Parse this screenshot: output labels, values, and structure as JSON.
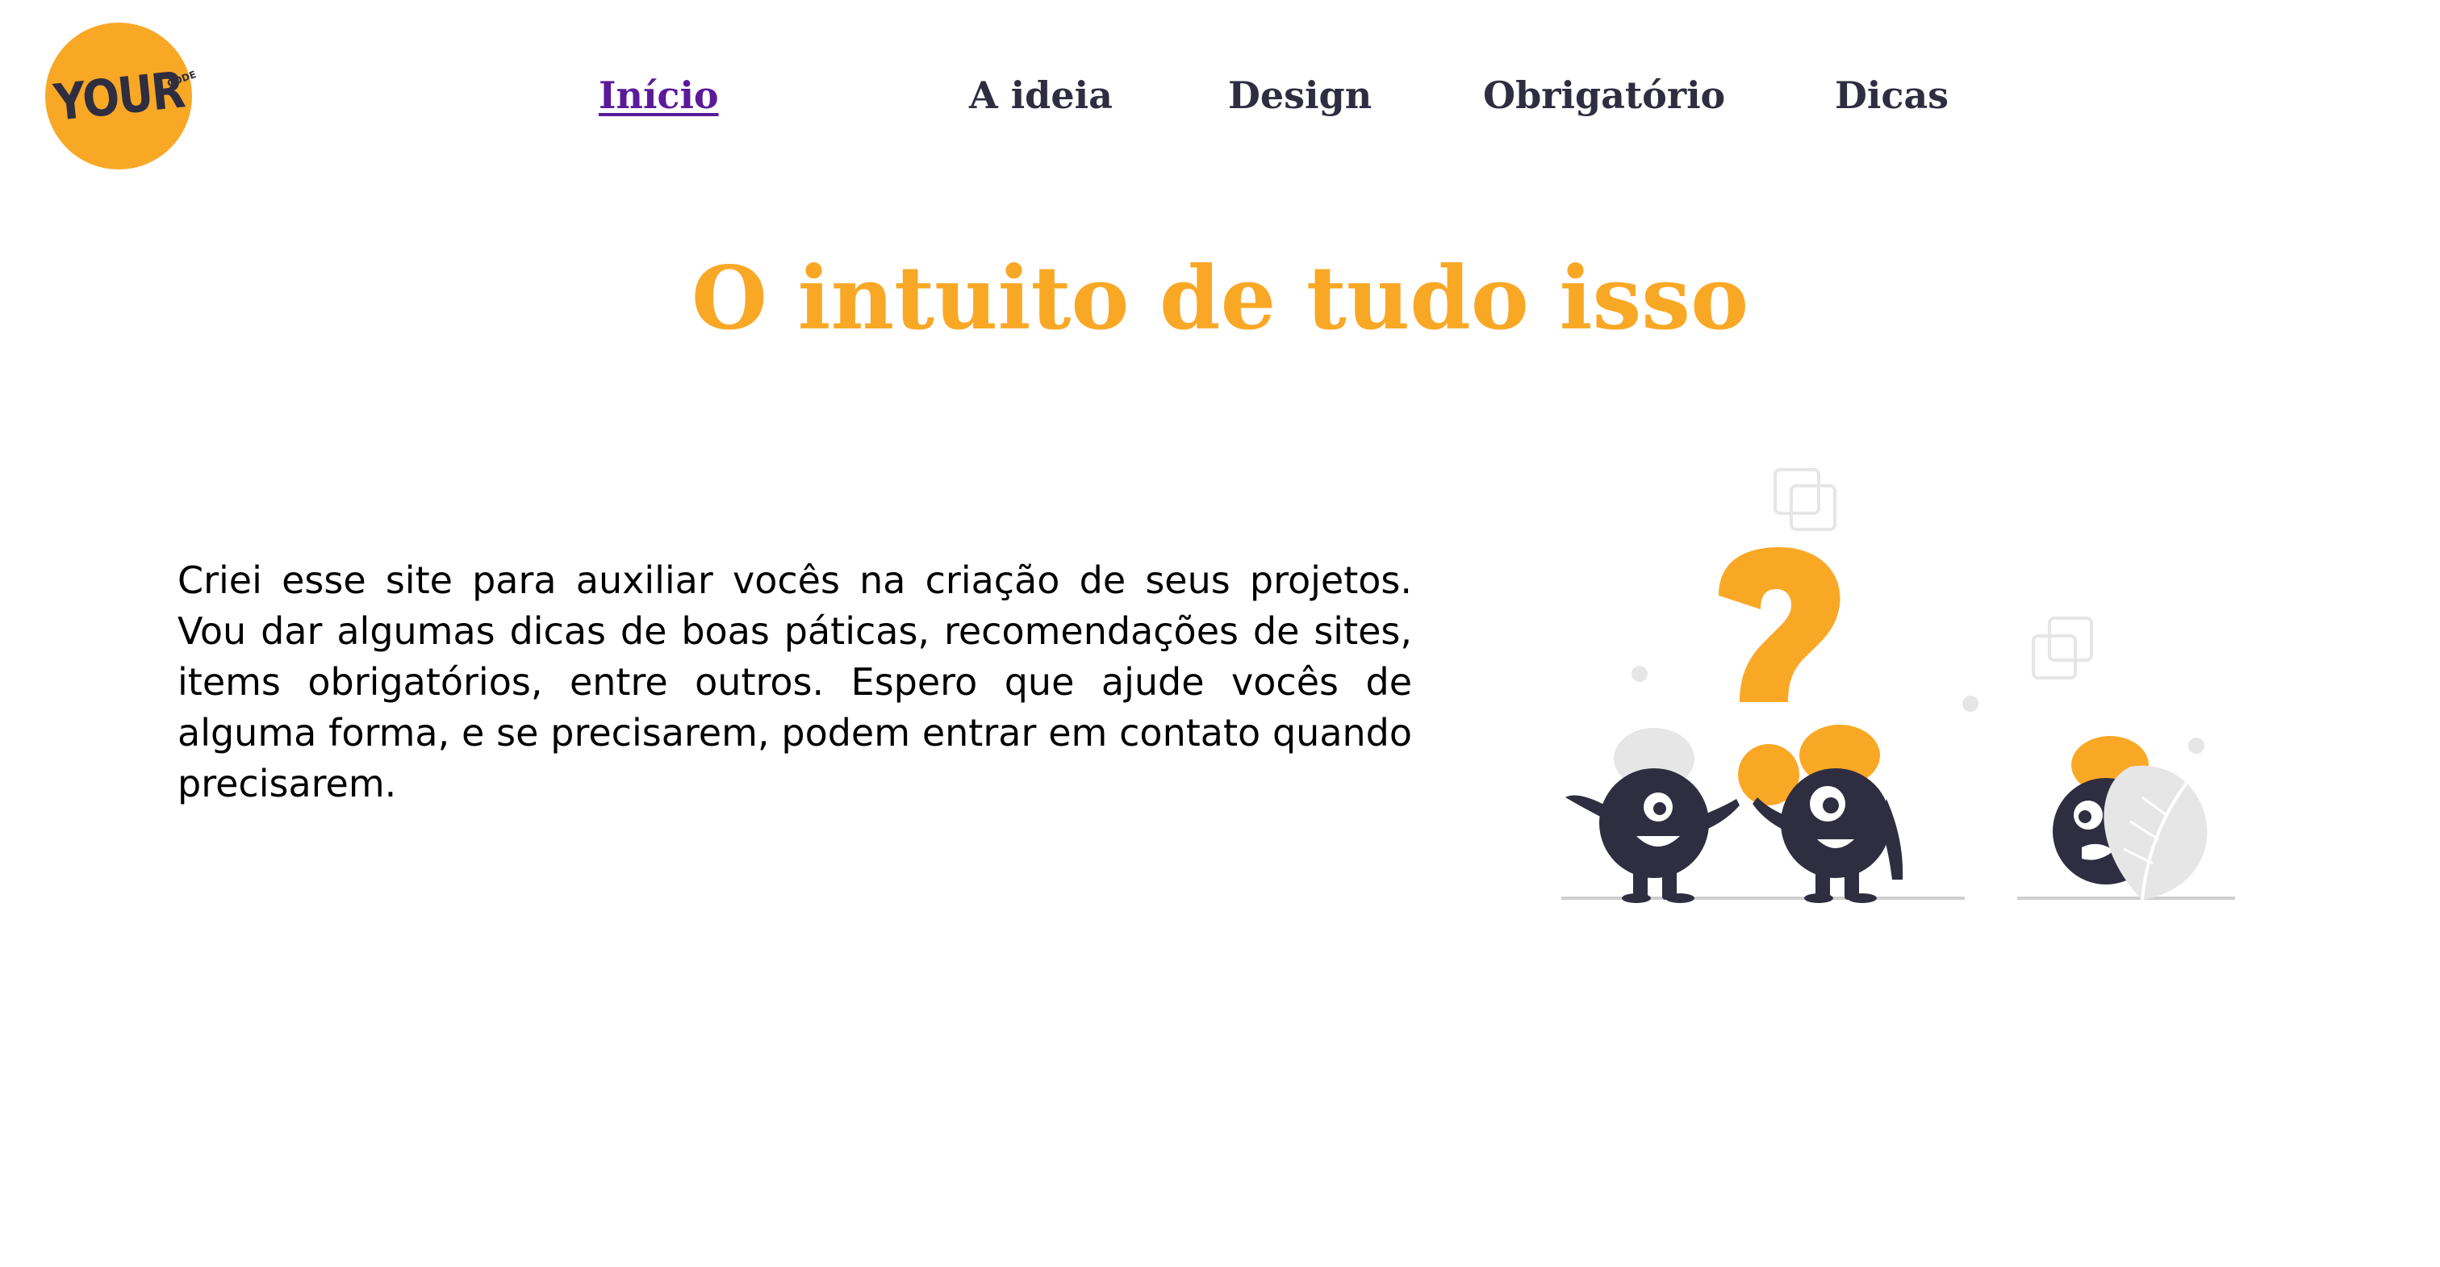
{
  "logo": {
    "text": "YOUR",
    "small_text": "CODE"
  },
  "nav": {
    "items": [
      {
        "label": "Início",
        "active": true
      },
      {
        "label": "A ideia",
        "active": false
      },
      {
        "label": "Design",
        "active": false
      },
      {
        "label": "Obrigatório",
        "active": false
      },
      {
        "label": "Dicas",
        "active": false
      }
    ]
  },
  "main": {
    "title": "O intuito de tudo isso",
    "paragraph": "Criei esse site para auxiliar vocês na criação de seus projetos. Vou dar algumas dicas de boas páticas, recomendações de sites, items obrigatórios, entre outros. Espero que ajude vocês de alguma forma, e se precisarem, podem entrar em contato quando precisarem."
  },
  "colors": {
    "accent": "#F9A826",
    "dark": "#2F2E41",
    "active_link": "#5B1A9A",
    "light_gray": "#E6E6E6"
  },
  "icons": {
    "illustration": "question-mark-characters-illustration"
  }
}
